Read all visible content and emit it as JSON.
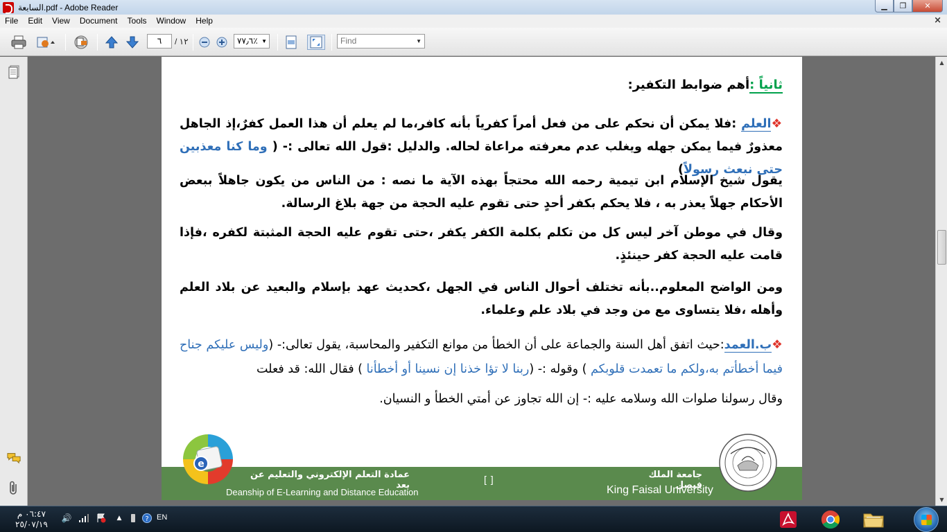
{
  "window": {
    "title": "السابعة.pdf - Adobe Reader",
    "minimize": "▁",
    "maximize": "❐",
    "close": "✕"
  },
  "menu": [
    "File",
    "Edit",
    "View",
    "Document",
    "Tools",
    "Window",
    "Help"
  ],
  "toolbar": {
    "page_current": "٦",
    "page_total": "/ ١٢",
    "zoom": "٧٧٫٦٪",
    "find_placeholder": "Find"
  },
  "document": {
    "heading_green": "ثانياً :",
    "heading_rest": "أهم ضوابط التكفير:",
    "p1_keyword": "العلم",
    "p1_text": " :فلا يمكن أن نحكم على من فعل أمراً كفرياً بأنه كافر،ما لم يعلم أن هذا العمل كفرٌ،إذ الجاهل معذورٌ فيما يمكن جهله ويغلب عدم معرفته مراعاة لحاله. والدليل :قول الله تعالى :- (",
    "p1_quote": " وما كنا معذبين حتى نبعث رسولاً",
    "p1_end": ")",
    "p2": "يقول شيخ الإسلام ابن تيمية رحمه الله محتجاً بهذه الآية ما نصه : من الناس من يكون جاهلاً ببعض الأحكام جهلاً يعذر به ، فلا يحكم بكفر أحدٍ حتى تقوم عليه الحجة من جهة بلاغ الرسالة.",
    "p3": "وقال في موطن آخر ليس كل من تكلم بكلمة الكفر يكفر ،حتى تقوم عليه الحجة المثبتة لكفره ،فإذا قامت عليه الحجة كفر حينئذٍ.",
    "p4": "ومن الواضح المعلوم..بأنه تختلف أحوال الناس في الجهل ،كحديث عهد بإسلام والبعيد عن بلاد العلم وأهله ،فلا يتساوى مع من وجد في بلاد علم وعلماء.",
    "p5_keyword": "ب.العمد",
    "p5_text_a": ":حيث اتفق أهل السنة والجماعة على أن الخطأ من موانع التكفير والمحاسبة، يقول تعالى:- (",
    "p5_quote_a": "وليس عليكم جناح فيما أخطأتم به،ولكم ما تعمدت قلوبكم",
    "p5_text_b": " ) وقوله :- (",
    "p5_quote_b": "ربنا لا تؤا خذنا إن نسينا أو أخطأنا",
    "p5_text_c": " ) فقال الله: قد فعلت",
    "p6": "وقال رسولنا صلوات الله وسلامه عليه :- إن الله تجاوز عن أمتي الخطأ و النسيان."
  },
  "footer": {
    "deanship_ar": "عمادة التعلم الإلكتروني والتعليم عن بعد",
    "deanship_en": "Deanship of E-Learning and Distance Education",
    "brackets": "[      ]",
    "university_ar": "جامعة الملك فيصل",
    "university_en": "King Faisal University"
  },
  "taskbar": {
    "time": "٠٦:٤٧ م",
    "date": "٢٥/٠٧/١٩",
    "language": "EN"
  },
  "colors": {
    "heading_green": "#00a14b",
    "quote_blue": "#2f6fb8",
    "bullet_red": "#e0342a",
    "footer_green": "#5a8a4d"
  }
}
